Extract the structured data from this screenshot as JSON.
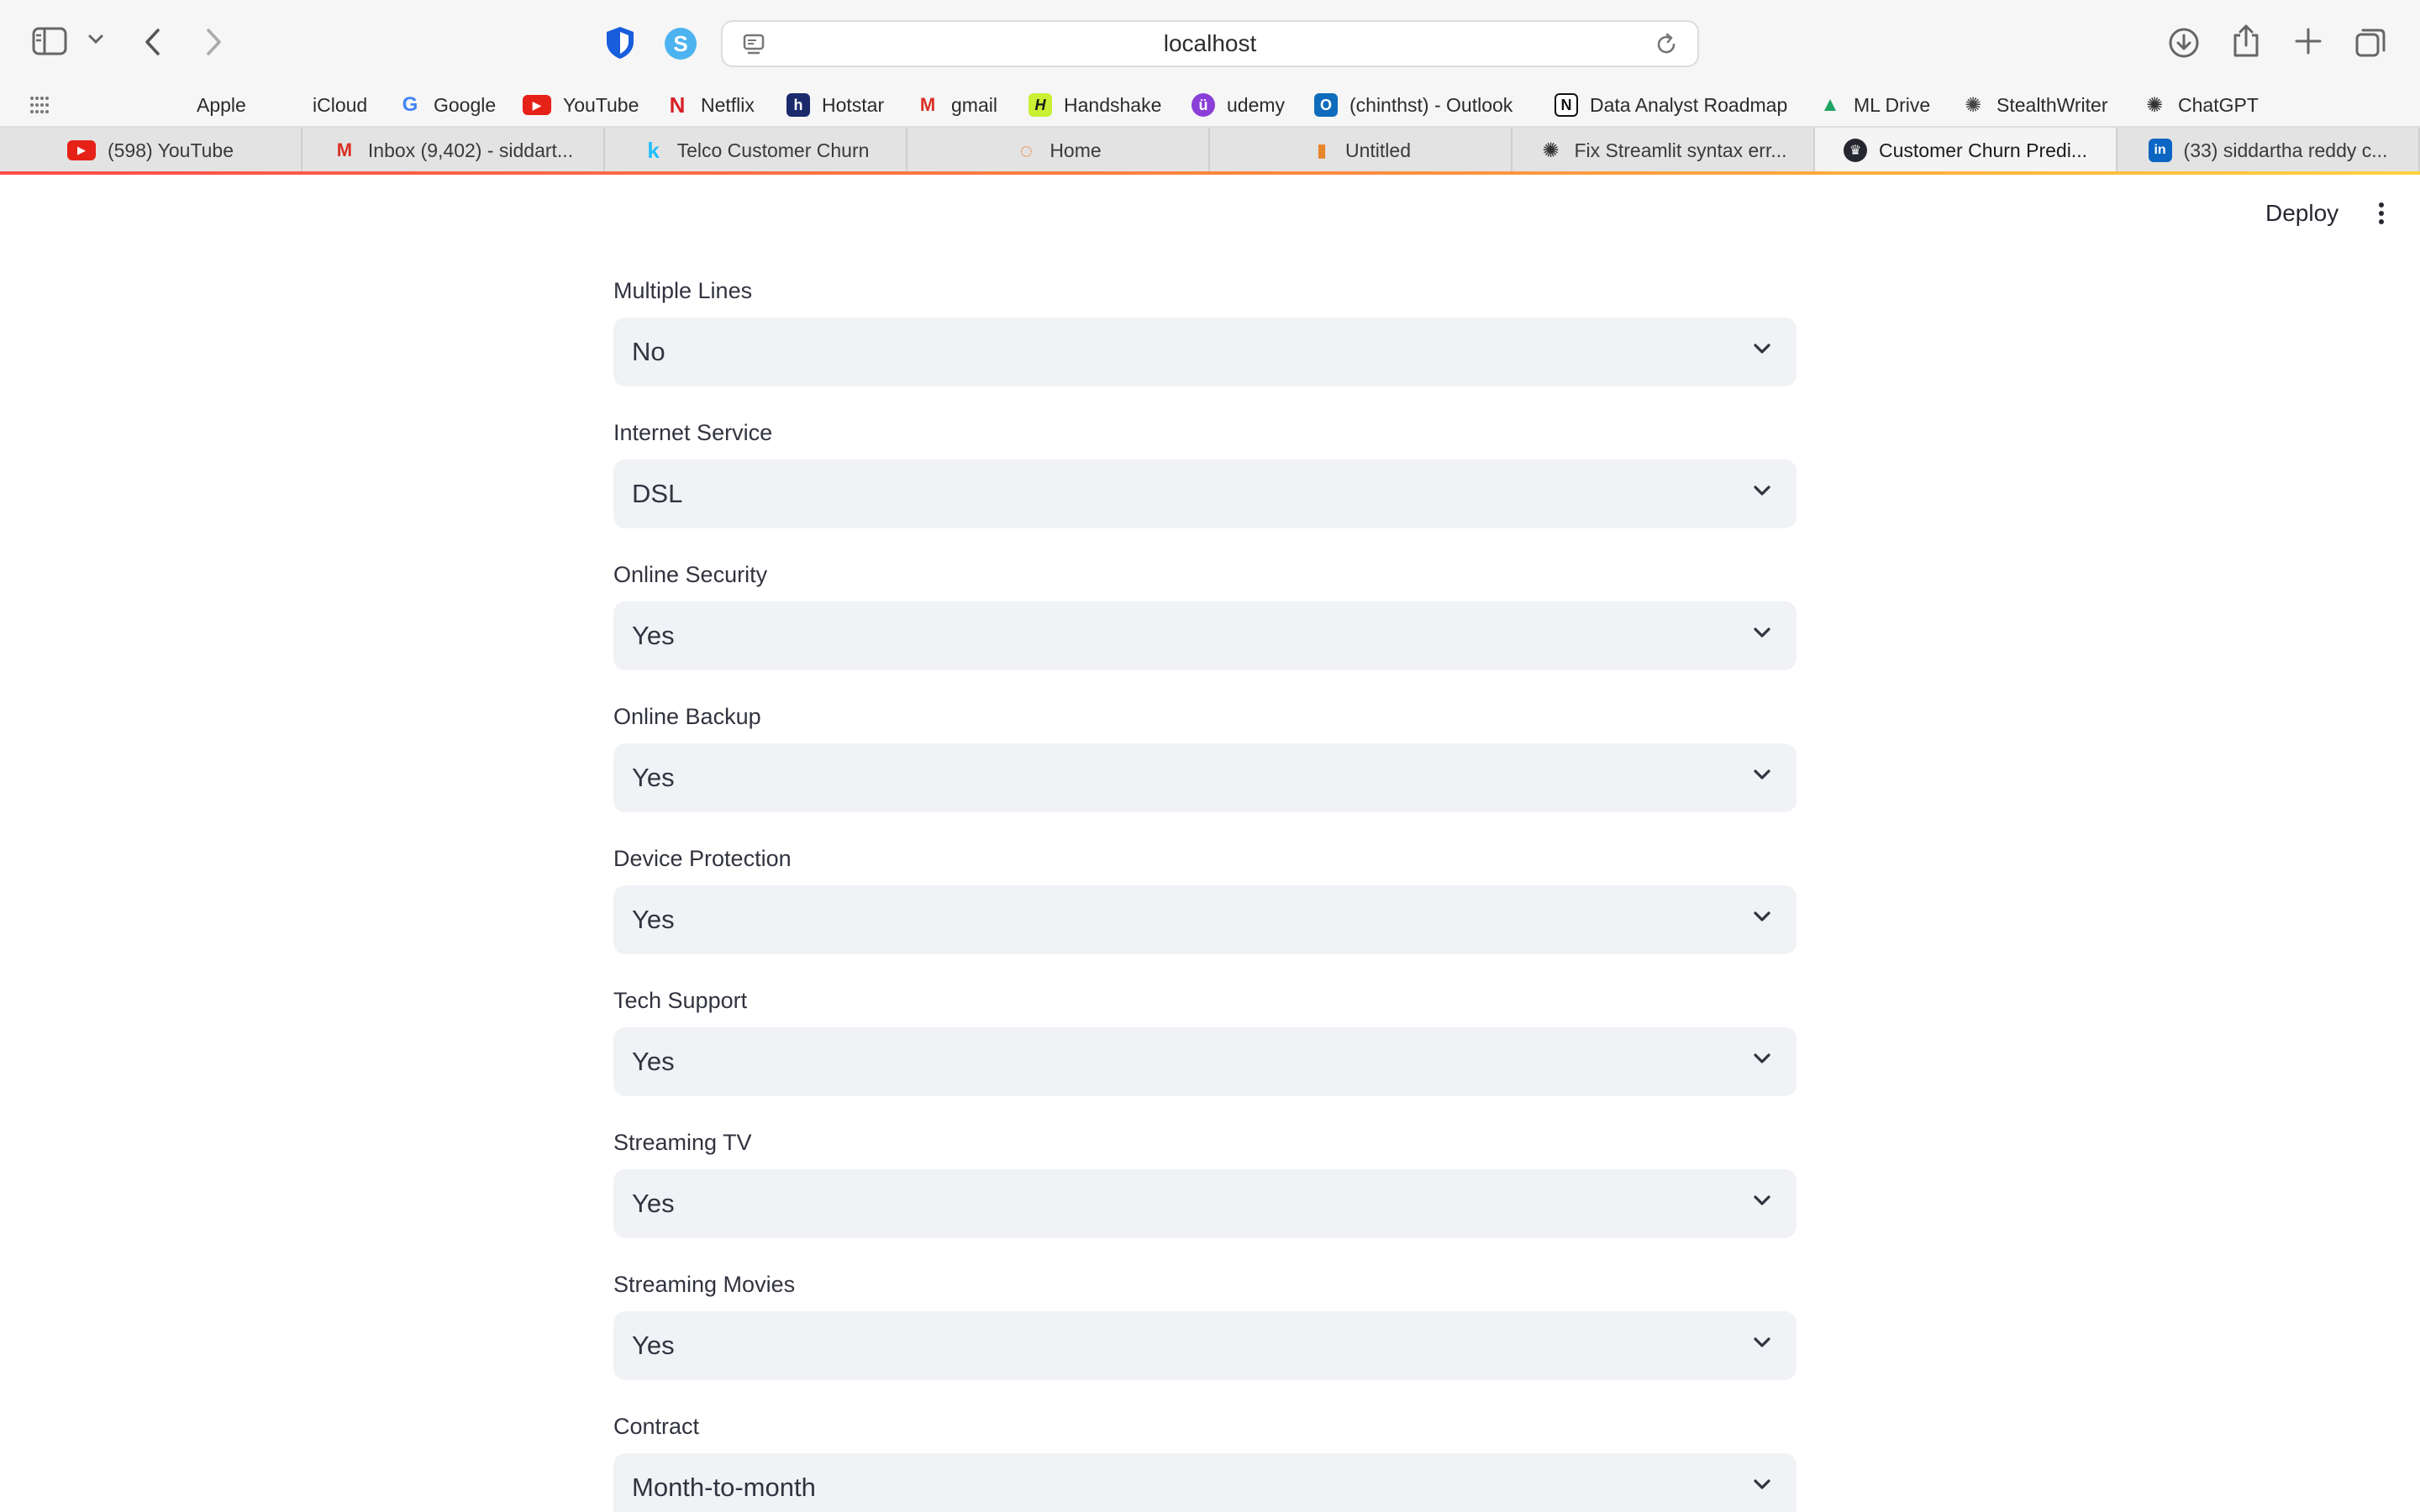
{
  "browser": {
    "address": "localhost",
    "bookmarks": [
      {
        "label": "Apple",
        "icon": "apple-icon",
        "color": "#1f1f1f",
        "glyph": ""
      },
      {
        "label": "iCloud",
        "icon": "apple-icon",
        "color": "#7a7a7a",
        "glyph": ""
      },
      {
        "label": "Google",
        "icon": "google-icon",
        "color": "#4285f4",
        "glyph": "G"
      },
      {
        "label": "YouTube",
        "icon": "youtube-icon",
        "color": "#e62117",
        "glyph": "▶"
      },
      {
        "label": "Netflix",
        "icon": "netflix-icon",
        "color": "#d81f26",
        "glyph": "N"
      },
      {
        "label": "Hotstar",
        "icon": "hotstar-icon",
        "color": "#1b2a6b",
        "glyph": "h"
      },
      {
        "label": "gmail",
        "icon": "gmail-icon",
        "color": "#d93025",
        "glyph": "M"
      },
      {
        "label": "Handshake",
        "icon": "handshake-icon",
        "color": "#c8f034",
        "glyph": "H"
      },
      {
        "label": "udemy",
        "icon": "udemy-icon",
        "color": "#8b3fd9",
        "glyph": "ü"
      },
      {
        "label": "(chinthst) - Outlook",
        "icon": "outlook-icon",
        "color": "#0f6cbd",
        "glyph": "O"
      },
      {
        "label": "Data Analyst Roadmap",
        "icon": "notion-icon",
        "color": "#111111",
        "glyph": "N"
      },
      {
        "label": "ML Drive",
        "icon": "google-drive-icon",
        "color": "#1fa463",
        "glyph": "▲"
      },
      {
        "label": "StealthWriter",
        "icon": "stealthwriter-icon",
        "color": "#444444",
        "glyph": "✺"
      },
      {
        "label": "ChatGPT",
        "icon": "chatgpt-icon",
        "color": "#333333",
        "glyph": "✺"
      }
    ],
    "tabs": [
      {
        "label": "(598) YouTube",
        "icon": "youtube-icon",
        "color": "#e62117",
        "glyph": "▶",
        "active": false
      },
      {
        "label": "Inbox (9,402) - siddart...",
        "icon": "gmail-icon",
        "color": "#d93025",
        "glyph": "M",
        "active": false
      },
      {
        "label": "Telco Customer Churn",
        "icon": "kaggle-icon",
        "color": "#20beff",
        "glyph": "k",
        "active": false
      },
      {
        "label": "Home",
        "icon": "jupyter-icon",
        "color": "#f37626",
        "glyph": "◌",
        "active": false
      },
      {
        "label": "Untitled",
        "icon": "notebook-icon",
        "color": "#e8862a",
        "glyph": "▮",
        "active": false
      },
      {
        "label": "Fix Streamlit syntax err...",
        "icon": "chatgpt-icon",
        "color": "#333333",
        "glyph": "✺",
        "active": false
      },
      {
        "label": "Customer Churn Predi...",
        "icon": "streamlit-icon",
        "color": "#262730",
        "glyph": "♛",
        "active": true
      },
      {
        "label": "(33) siddartha reddy c...",
        "icon": "linkedin-icon",
        "color": "#0a66c2",
        "glyph": "in",
        "active": false
      }
    ]
  },
  "app": {
    "deploy_label": "Deploy",
    "fields": [
      {
        "label": "Multiple Lines",
        "value": "No"
      },
      {
        "label": "Internet Service",
        "value": "DSL"
      },
      {
        "label": "Online Security",
        "value": "Yes"
      },
      {
        "label": "Online Backup",
        "value": "Yes"
      },
      {
        "label": "Device Protection",
        "value": "Yes"
      },
      {
        "label": "Tech Support",
        "value": "Yes"
      },
      {
        "label": "Streaming TV",
        "value": "Yes"
      },
      {
        "label": "Streaming Movies",
        "value": "Yes"
      },
      {
        "label": "Contract",
        "value": "Month-to-month"
      }
    ]
  },
  "colors": {
    "select_bg": "#f0f2f6",
    "text": "#31333f",
    "accent_line": "#ff4b4b"
  }
}
